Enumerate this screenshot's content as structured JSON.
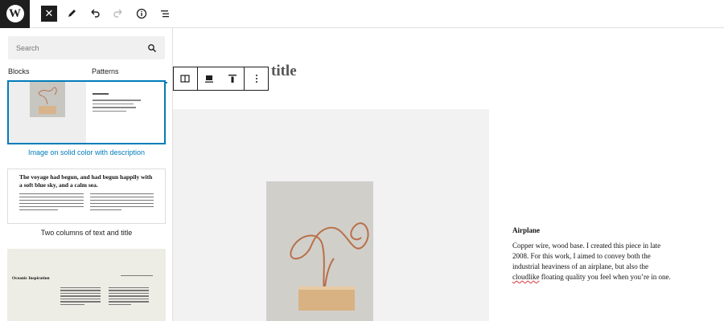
{
  "topbar": {
    "logo_letter": "W",
    "close_glyph": "✕",
    "icons": [
      "wordpress-logo",
      "close-icon",
      "pencil-icon",
      "undo-icon",
      "redo-icon",
      "info-icon",
      "list-view-icon"
    ]
  },
  "inserter": {
    "search_placeholder": "Search",
    "tabs": [
      "Blocks",
      "Patterns"
    ],
    "active_tab": "Patterns",
    "patterns": [
      {
        "label": "Image on solid color with description",
        "selected": true
      },
      {
        "label": "Two columns of text and title",
        "preview_title": "The voyage had begun, and had begun happily with a soft blue sky, and a calm sea."
      },
      {
        "label": "",
        "preview_title": "Oceanic Inspiration"
      }
    ]
  },
  "editor": {
    "title_partial": "title",
    "caption_title": "Airplane",
    "caption_body_1": "Copper wire, wood base. I created this piece in late 2008. For this work, I aimed to convey both the industrial heaviness of an airplane, but also the ",
    "caption_misspelled": "cloudlike",
    "caption_body_2": " floating quality you feel when you’re in one."
  },
  "colors": {
    "accent": "#007cba",
    "dark": "#1e1e1e"
  }
}
